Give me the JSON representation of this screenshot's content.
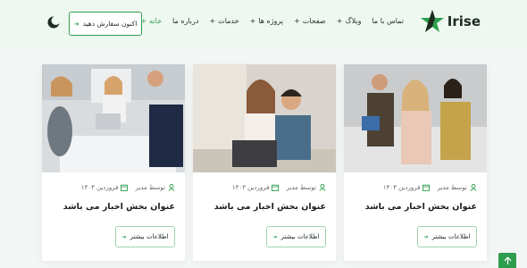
{
  "header": {
    "logo_text": "Irise",
    "nav": [
      {
        "label": "خانه",
        "icon": "plus-icon",
        "active": true
      },
      {
        "label": "درباره ما",
        "icon": "",
        "active": false
      },
      {
        "label": "خدمات",
        "icon": "plus-icon",
        "active": false
      },
      {
        "label": "پروژه ها",
        "icon": "plus-icon",
        "active": false
      },
      {
        "label": "صفحات",
        "icon": "plus-icon",
        "active": false
      },
      {
        "label": "وبلاگ",
        "icon": "plus-icon",
        "active": false
      },
      {
        "label": "تماس با ما",
        "icon": "",
        "active": false
      }
    ],
    "cta_label": "اکنون سفارش دهید",
    "cta_icon": "arrow-left-icon",
    "theme_icon": "moon-icon"
  },
  "cards": [
    {
      "author": "توسط مدیر",
      "date": "فروردین ۱۴۰۳",
      "title": "عنوان بخش اخبار می باشد",
      "button": "اطلاعات بیشتر"
    },
    {
      "author": "توسط مدیر",
      "date": "فروردین ۱۴۰۳",
      "title": "عنوان بخش اخبار می باشد",
      "button": "اطلاعات بیشتر"
    },
    {
      "author": "توسط مدیر",
      "date": "فروردین ۱۴۰۳",
      "title": "عنوان بخش اخبار می باشد",
      "button": "اطلاعات بیشتر"
    }
  ],
  "colors": {
    "accent": "#2e9e4e",
    "header_bg": "#eef7f0",
    "page_bg": "#f4f6f5"
  },
  "scroll_top_icon": "arrow-up-icon"
}
